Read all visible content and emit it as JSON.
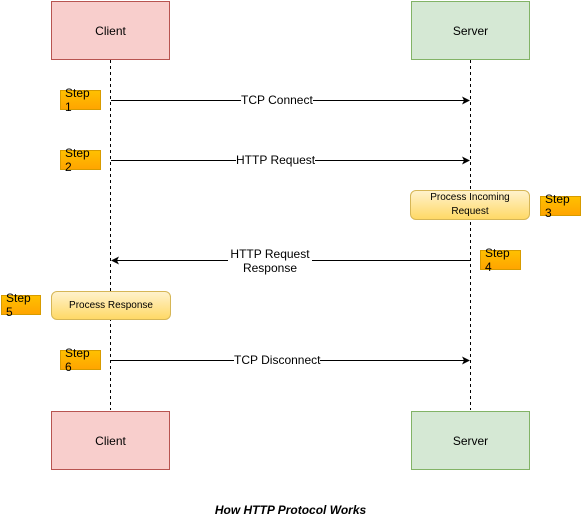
{
  "title": "How HTTP Protocol Works",
  "actors": {
    "client_top": "Client",
    "server_top": "Server",
    "client_bottom": "Client",
    "server_bottom": "Server"
  },
  "messages": [
    {
      "label": "TCP Connect",
      "from": "Client",
      "to": "Server",
      "step": "Step 1"
    },
    {
      "label": "HTTP Request",
      "from": "Client",
      "to": "Server",
      "step": "Step 2"
    },
    {
      "label": "HTTP Request\nResponse",
      "from": "Server",
      "to": "Client",
      "step": "Step 4"
    },
    {
      "label": "TCP Disconnect",
      "from": "Client",
      "to": "Server",
      "step": "Step 6"
    }
  ],
  "processes": [
    {
      "label": "Process Incoming Request",
      "actor": "Server",
      "step": "Step 3"
    },
    {
      "label": "Process Response",
      "actor": "Client",
      "step": "Step 5"
    }
  ],
  "steps": [
    "Step 1",
    "Step 2",
    "Step 3",
    "Step 4",
    "Step 5",
    "Step 6"
  ],
  "colors": {
    "client_fill": "#f8cecc",
    "client_stroke": "#b85450",
    "server_fill": "#d5e8d4",
    "server_stroke": "#82b366",
    "step_fill": "#ffa500",
    "process_fill": "#fff2cc"
  }
}
